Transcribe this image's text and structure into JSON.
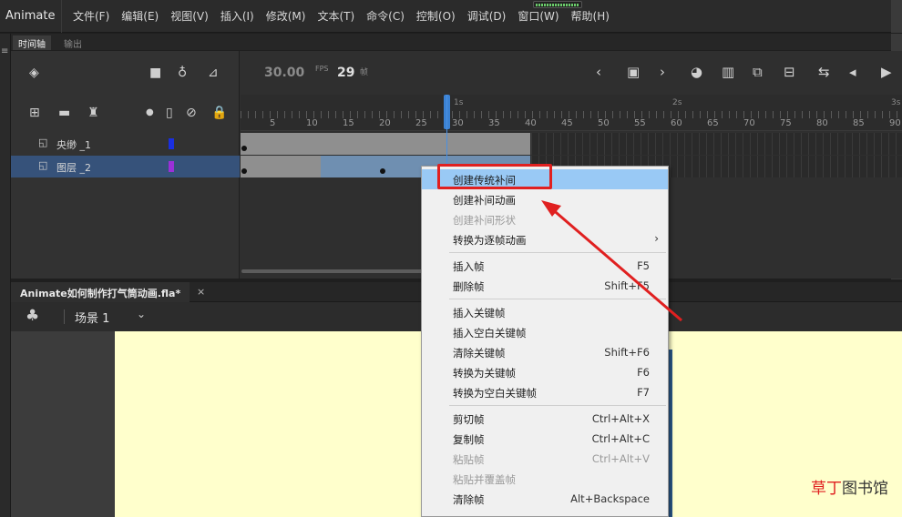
{
  "app": {
    "name": "Animate"
  },
  "menu": [
    "文件(F)",
    "编辑(E)",
    "视图(V)",
    "插入(I)",
    "修改(M)",
    "文本(T)",
    "命令(C)",
    "控制(O)",
    "调试(D)",
    "窗口(W)",
    "帮助(H)"
  ],
  "panel_tabs": {
    "timeline": "时间轴",
    "output": "输出"
  },
  "timeline": {
    "fps_value": "30.00",
    "fps_unit": "FPS",
    "current_frame": "29",
    "frame_unit": "帧",
    "ruler_numbers": [
      "5",
      "10",
      "15",
      "20",
      "25",
      "30",
      "35",
      "40",
      "45",
      "50",
      "55",
      "60",
      "65",
      "70",
      "75",
      "80",
      "85",
      "90"
    ],
    "ruler_seconds": [
      "1s",
      "2s",
      "3s"
    ],
    "layers": [
      {
        "name": "央缈 _1",
        "color": "#1a2fe0",
        "selected": false
      },
      {
        "name": "图层 _2",
        "color": "#9b30d8",
        "selected": true
      }
    ]
  },
  "document": {
    "tab_title": "Animate如何制作打气筒动画.fla*",
    "close": "×"
  },
  "scene": {
    "label": "场景 1"
  },
  "context_menu": {
    "items": [
      {
        "label": "创建传统补间",
        "shortcut": "",
        "highlighted": true,
        "disabled": false
      },
      {
        "label": "创建补间动画",
        "shortcut": "",
        "highlighted": false,
        "disabled": false
      },
      {
        "label": "创建补间形状",
        "shortcut": "",
        "highlighted": false,
        "disabled": true
      },
      {
        "label": "转换为逐帧动画",
        "shortcut": "",
        "highlighted": false,
        "disabled": false,
        "submenu": true
      },
      {
        "label": "插入帧",
        "shortcut": "F5",
        "highlighted": false,
        "disabled": false
      },
      {
        "label": "删除帧",
        "shortcut": "Shift+F5",
        "highlighted": false,
        "disabled": false
      },
      {
        "label": "插入关键帧",
        "shortcut": "",
        "highlighted": false,
        "disabled": false
      },
      {
        "label": "插入空白关键帧",
        "shortcut": "",
        "highlighted": false,
        "disabled": false
      },
      {
        "label": "清除关键帧",
        "shortcut": "Shift+F6",
        "highlighted": false,
        "disabled": false
      },
      {
        "label": "转换为关键帧",
        "shortcut": "F6",
        "highlighted": false,
        "disabled": false
      },
      {
        "label": "转换为空白关键帧",
        "shortcut": "F7",
        "highlighted": false,
        "disabled": false
      },
      {
        "label": "剪切帧",
        "shortcut": "Ctrl+Alt+X",
        "highlighted": false,
        "disabled": false
      },
      {
        "label": "复制帧",
        "shortcut": "Ctrl+Alt+C",
        "highlighted": false,
        "disabled": false
      },
      {
        "label": "粘贴帧",
        "shortcut": "Ctrl+Alt+V",
        "highlighted": false,
        "disabled": true
      },
      {
        "label": "粘贴并覆盖帧",
        "shortcut": "",
        "highlighted": false,
        "disabled": true
      },
      {
        "label": "清除帧",
        "shortcut": "Alt+Backspace",
        "highlighted": false,
        "disabled": false
      }
    ],
    "submenu_arrow": "›"
  },
  "watermark": {
    "part1": "草丁",
    "part2": "图书馆"
  },
  "colors": {
    "highlight": "#99c9f5",
    "annotation": "#e02020",
    "selected_layer": "#36527a",
    "stage": "#ffffcc"
  }
}
